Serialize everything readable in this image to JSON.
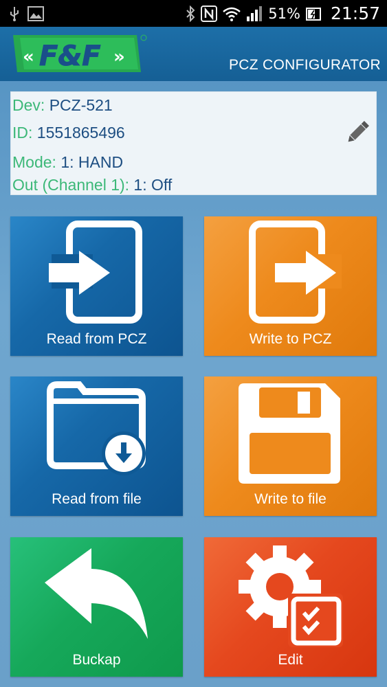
{
  "status_bar": {
    "battery": "51%",
    "time": "21:57",
    "icons": [
      "usb-icon",
      "image-icon",
      "bluetooth-icon",
      "nfc-icon",
      "wifi-icon",
      "signal-icon",
      "battery-icon"
    ]
  },
  "header": {
    "logo_text": "F&F",
    "title": "PCZ CONFIGURATOR"
  },
  "info": {
    "dev_label": "Dev:",
    "dev_value": "PCZ-521",
    "id_label": "ID:",
    "id_value": "1551865496",
    "mode_label": "Mode:",
    "mode_value": "1: HAND",
    "out_label": "Out (Channel 1):",
    "out_value": "1: Off"
  },
  "tiles": [
    {
      "label": "Read from PCZ",
      "icon": "read-from-device-icon",
      "color": "#1668a8"
    },
    {
      "label": "Write to PCZ",
      "icon": "write-to-device-icon",
      "color": "#ee8a1c"
    },
    {
      "label": "Read from file",
      "icon": "folder-download-icon",
      "color": "#1668a8"
    },
    {
      "label": "Write to file",
      "icon": "floppy-disk-icon",
      "color": "#ee8a1c"
    },
    {
      "label": "Buckap",
      "icon": "back-arrow-icon",
      "color": "#16a85a"
    },
    {
      "label": "Edit",
      "icon": "gear-checklist-icon",
      "color": "#e5481e"
    }
  ],
  "colors": {
    "label_green": "#3cb878",
    "value_blue": "#1d4e82",
    "header_blue": "#155f95"
  }
}
